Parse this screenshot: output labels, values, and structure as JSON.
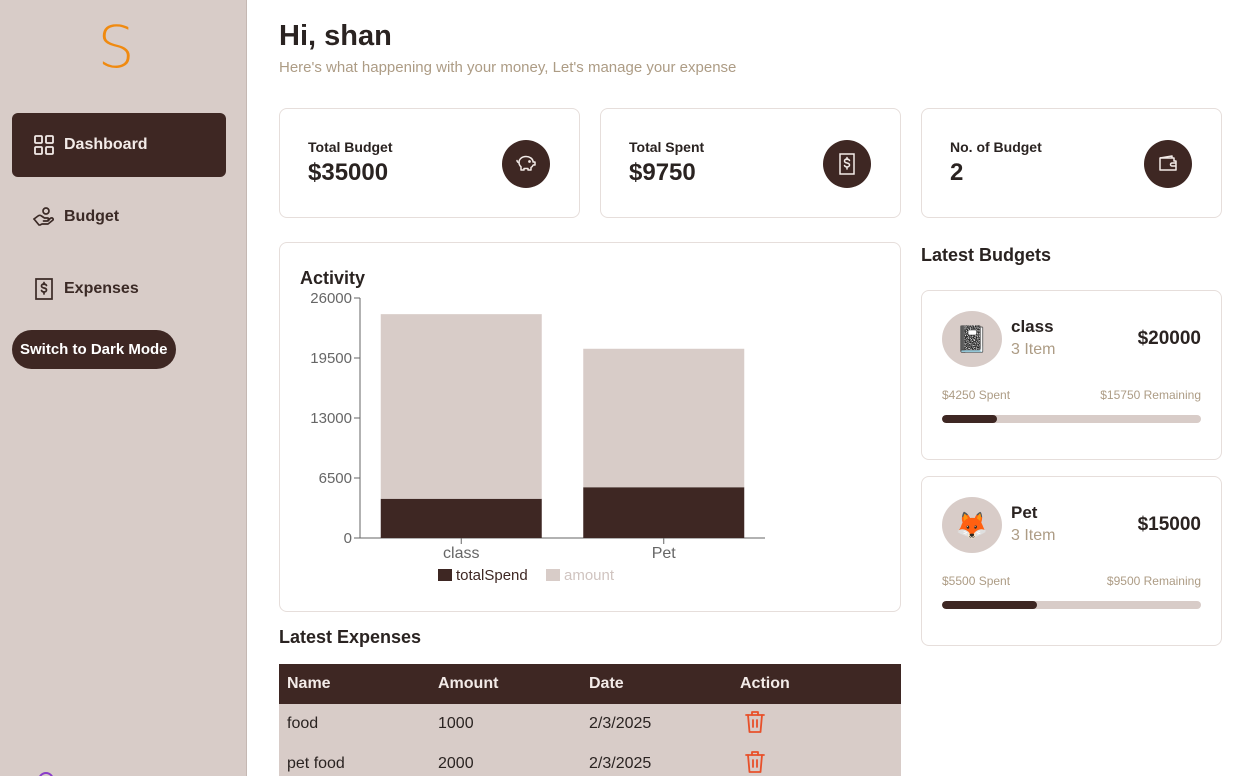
{
  "app": {
    "logo_letter": "S",
    "logo_color": "#f08a10",
    "accent": "#3e2723",
    "muted": "#d8ccc8"
  },
  "sidebar": {
    "items": [
      {
        "label": "Dashboard",
        "icon": "dashboard-grid-icon",
        "active": true
      },
      {
        "label": "Budget",
        "icon": "hand-coin-icon",
        "active": false
      },
      {
        "label": "Expenses",
        "icon": "receipt-dollar-icon",
        "active": false
      }
    ],
    "dark_mode_label": "Switch to Dark Mode"
  },
  "header": {
    "greeting": "Hi, shan",
    "subtitle": "Here's what happening with your money, Let's manage your expense"
  },
  "stats": [
    {
      "label": "Total Budget",
      "value": "$35000",
      "icon": "piggy-bank-icon"
    },
    {
      "label": "Total Spent",
      "value": "$9750",
      "icon": "receipt-dollar-icon"
    },
    {
      "label": "No. of Budget",
      "value": "2",
      "icon": "wallet-icon"
    }
  ],
  "activity": {
    "title": "Activity"
  },
  "chart_data": {
    "type": "bar",
    "stacked": true,
    "categories": [
      "class",
      "Pet"
    ],
    "series": [
      {
        "name": "totalSpend",
        "values": [
          4250,
          5500
        ],
        "color": "#3e2723"
      },
      {
        "name": "amount",
        "values": [
          20000,
          15000
        ],
        "color": "#d8ccc8"
      }
    ],
    "yticks": [
      "0",
      "6500",
      "13000",
      "19500",
      "26000"
    ],
    "ylim": [
      0,
      26000
    ],
    "legend": "bottom"
  },
  "latest_budgets": {
    "title": "Latest Budgets",
    "items": [
      {
        "name": "class",
        "items": "3 Item",
        "amount": "$20000",
        "spent": "$4250 Spent",
        "remaining": "$15750 Remaining",
        "progress": 0.2125,
        "emoji": "📓"
      },
      {
        "name": "Pet",
        "items": "3 Item",
        "amount": "$15000",
        "spent": "$5500 Spent",
        "remaining": "$9500 Remaining",
        "progress": 0.3667,
        "emoji": "🦊"
      }
    ]
  },
  "latest_expenses": {
    "title": "Latest Expenses",
    "columns": [
      "Name",
      "Amount",
      "Date",
      "Action"
    ],
    "rows": [
      {
        "name": "food",
        "amount": "1000",
        "date": "2/3/2025"
      },
      {
        "name": "pet food",
        "amount": "2000",
        "date": "2/3/2025"
      }
    ],
    "delete_icon_color": "#e8502a"
  }
}
